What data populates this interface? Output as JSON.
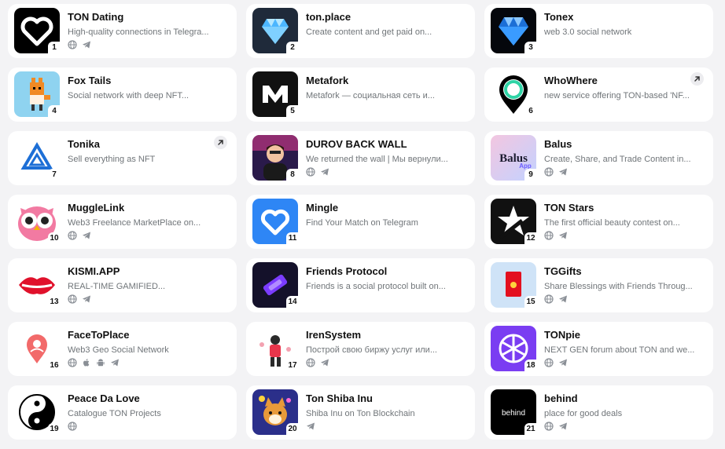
{
  "colors": {
    "accent": "#2b7fff",
    "muted": "#707579",
    "page_bg": "#f3f3f5",
    "card_bg": "#ffffff"
  },
  "apps": [
    {
      "rank": "1",
      "title": "TON Dating",
      "description": "High-quality connections in Telegra...",
      "links": [
        "web",
        "telegram"
      ],
      "external": false,
      "thumb": "heart-white-on-black"
    },
    {
      "rank": "2",
      "title": "ton.place",
      "description": "Create content and get paid on...",
      "links": [],
      "external": false,
      "thumb": "diamond-blue"
    },
    {
      "rank": "3",
      "title": "Tonex",
      "description": "web 3.0 social network",
      "links": [],
      "external": false,
      "thumb": "diamond-dark"
    },
    {
      "rank": "4",
      "title": "Fox Tails",
      "description": "Social network with deep NFT...",
      "links": [],
      "external": false,
      "thumb": "fox"
    },
    {
      "rank": "5",
      "title": "Metafork",
      "description": "Metafork — социальная сеть и...",
      "links": [],
      "external": false,
      "thumb": "m-logo"
    },
    {
      "rank": "6",
      "title": "WhoWhere",
      "description": "new service offering TON-based 'NF...",
      "links": [],
      "external": true,
      "thumb": "location-pin"
    },
    {
      "rank": "7",
      "title": "Tonika",
      "description": "Sell everything as NFT",
      "links": [],
      "external": true,
      "thumb": "triangle"
    },
    {
      "rank": "8",
      "title": "DUROV BACK WALL",
      "description": "We returned the wall | Мы вернули...",
      "links": [
        "web",
        "telegram"
      ],
      "external": false,
      "thumb": "avatar-person"
    },
    {
      "rank": "9",
      "title": "Balus",
      "description": "Create, Share, and Trade Content in...",
      "links": [
        "web",
        "telegram"
      ],
      "external": false,
      "thumb": "balus"
    },
    {
      "rank": "10",
      "title": "MuggleLink",
      "description": "Web3 Freelance MarketPlace on...",
      "links": [
        "web",
        "telegram"
      ],
      "external": false,
      "thumb": "owl"
    },
    {
      "rank": "11",
      "title": "Mingle",
      "description": "Find Your Match on Telegram",
      "links": [],
      "external": false,
      "thumb": "heart-white-on-blue"
    },
    {
      "rank": "12",
      "title": "TON Stars",
      "description": "The first official beauty contest on...",
      "links": [
        "web",
        "telegram"
      ],
      "external": false,
      "thumb": "star"
    },
    {
      "rank": "13",
      "title": "KISMI.APP",
      "description": "REAL-TIME GAMIFIED...",
      "links": [
        "web",
        "telegram"
      ],
      "external": false,
      "thumb": "lips"
    },
    {
      "rank": "14",
      "title": "Friends Protocol",
      "description": "Friends is a social protocol built on...",
      "links": [],
      "external": false,
      "thumb": "friends"
    },
    {
      "rank": "15",
      "title": "TGGifts",
      "description": "Share Blessings with Friends Throug...",
      "links": [
        "web",
        "telegram"
      ],
      "external": false,
      "thumb": "red-envelope"
    },
    {
      "rank": "16",
      "title": "FaceToPlace",
      "description": "Web3 Geo Social Network",
      "links": [
        "web",
        "apple",
        "android",
        "telegram"
      ],
      "external": false,
      "thumb": "face-pin"
    },
    {
      "rank": "17",
      "title": "IrenSystem",
      "description": "Построй свою биржу услуг или...",
      "links": [
        "web",
        "telegram"
      ],
      "external": false,
      "thumb": "illustration"
    },
    {
      "rank": "18",
      "title": "TONpie",
      "description": "NEXT GEN forum about TON and we...",
      "links": [
        "web",
        "telegram"
      ],
      "external": false,
      "thumb": "pie"
    },
    {
      "rank": "19",
      "title": "Peace Da Love",
      "description": "Catalogue TON Projects",
      "links": [
        "web"
      ],
      "external": false,
      "thumb": "yin-yang"
    },
    {
      "rank": "20",
      "title": "Ton Shiba Inu",
      "description": "Shiba Inu on Ton Blockchain",
      "links": [
        "telegram"
      ],
      "external": false,
      "thumb": "shiba"
    },
    {
      "rank": "21",
      "title": "behind",
      "description": "place for good deals",
      "links": [
        "web",
        "telegram"
      ],
      "external": false,
      "thumb": "behind",
      "thumb_text": "behind"
    }
  ],
  "balus_logo_text": "Balus"
}
